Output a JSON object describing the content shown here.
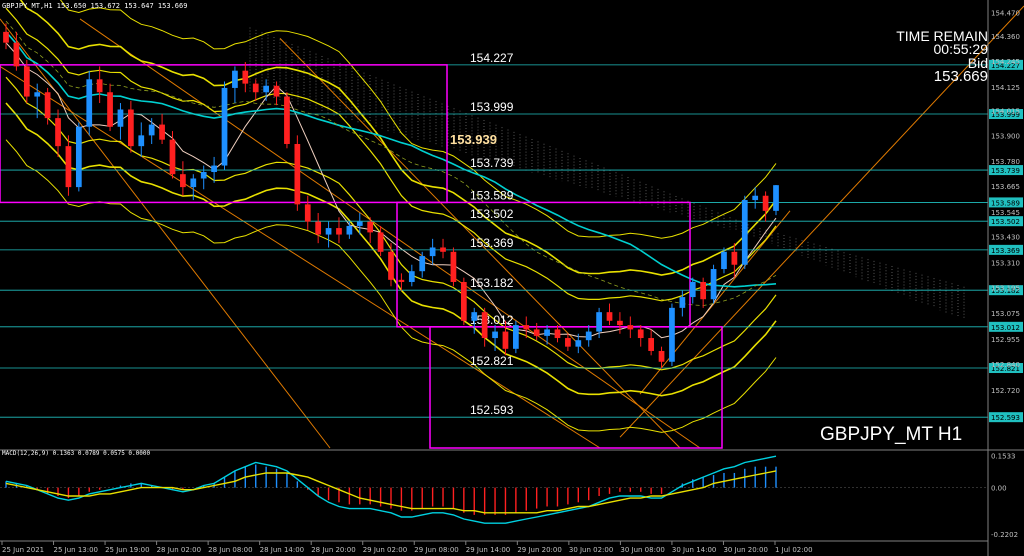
{
  "header": {
    "text": "GBPJPY_MT,H1  153.650 153.672 153.647 153.669"
  },
  "info": {
    "label": "TIME REMAIN",
    "countdown": "00:55:29",
    "bid_label": "Bid",
    "bid_value": "153.669"
  },
  "symbol_label": "GBPJPY_MT H1",
  "macd_header": "MACD(12,26,9) 0.1363 0.0789 0.0575 0.0000",
  "chart_data": {
    "type": "candlestick",
    "price_axis": {
      "min": 152.45,
      "max": 154.5,
      "ticks": [
        "154.470",
        "154.360",
        "154.245",
        "154.125",
        "154.015",
        "153.900",
        "153.780",
        "153.665",
        "153.545",
        "153.430",
        "153.310",
        "153.195",
        "153.075",
        "152.955",
        "152.840",
        "152.720"
      ]
    },
    "x_ticks": [
      "25 Jun 2021",
      "25 Jun 13:00",
      "25 Jun 19:00",
      "28 Jun 02:00",
      "28 Jun 08:00",
      "28 Jun 14:00",
      "28 Jun 20:00",
      "29 Jun 02:00",
      "29 Jun 08:00",
      "29 Jun 14:00",
      "29 Jun 20:00",
      "30 Jun 02:00",
      "30 Jun 08:00",
      "30 Jun 14:00",
      "30 Jun 20:00",
      "1 Jul 02:00"
    ],
    "levels": [
      {
        "label": "154.227",
        "value": 154.227
      },
      {
        "label": "153.999",
        "value": 153.999
      },
      {
        "label": "153.739",
        "value": 153.739
      },
      {
        "label": "153.589",
        "value": 153.589
      },
      {
        "label": "153.502",
        "value": 153.502
      },
      {
        "label": "153.369",
        "value": 153.369
      },
      {
        "label": "153.182",
        "value": 153.182
      },
      {
        "label": "153.012",
        "value": 153.012
      },
      {
        "label": "152.821",
        "value": 152.821
      },
      {
        "label": "152.593",
        "value": 152.593
      }
    ],
    "highlight_label": "153.939",
    "candles": [
      [
        154.38,
        154.42,
        154.3,
        154.33
      ],
      [
        154.33,
        154.38,
        154.2,
        154.22
      ],
      [
        154.22,
        154.25,
        154.05,
        154.08
      ],
      [
        154.08,
        154.14,
        153.98,
        154.1
      ],
      [
        154.1,
        154.12,
        153.95,
        153.98
      ],
      [
        153.98,
        154.02,
        153.8,
        153.85
      ],
      [
        153.85,
        153.9,
        153.62,
        153.66
      ],
      [
        153.66,
        153.96,
        153.64,
        153.94
      ],
      [
        153.94,
        154.2,
        153.9,
        154.16
      ],
      [
        154.16,
        154.22,
        154.05,
        154.1
      ],
      [
        154.1,
        154.14,
        153.92,
        153.94
      ],
      [
        153.94,
        154.05,
        153.88,
        154.02
      ],
      [
        154.02,
        154.06,
        153.82,
        153.85
      ],
      [
        153.85,
        153.96,
        153.8,
        153.9
      ],
      [
        153.9,
        153.98,
        153.86,
        153.95
      ],
      [
        153.95,
        154.0,
        153.86,
        153.88
      ],
      [
        153.88,
        153.92,
        153.7,
        153.72
      ],
      [
        153.72,
        153.78,
        153.62,
        153.66
      ],
      [
        153.66,
        153.72,
        153.6,
        153.7
      ],
      [
        153.7,
        153.76,
        153.65,
        153.73
      ],
      [
        153.73,
        153.8,
        153.68,
        153.76
      ],
      [
        153.76,
        154.15,
        153.74,
        154.12
      ],
      [
        154.12,
        154.22,
        154.05,
        154.2
      ],
      [
        154.2,
        154.24,
        154.1,
        154.14
      ],
      [
        154.14,
        154.16,
        154.06,
        154.1
      ],
      [
        154.1,
        154.16,
        154.06,
        154.13
      ],
      [
        154.13,
        154.15,
        154.04,
        154.08
      ],
      [
        154.08,
        154.1,
        153.84,
        153.86
      ],
      [
        153.86,
        153.9,
        153.55,
        153.58
      ],
      [
        153.58,
        153.62,
        153.46,
        153.5
      ],
      [
        153.5,
        153.54,
        153.4,
        153.44
      ],
      [
        153.44,
        153.5,
        153.38,
        153.47
      ],
      [
        153.47,
        153.52,
        153.4,
        153.44
      ],
      [
        153.44,
        153.5,
        153.42,
        153.48
      ],
      [
        153.48,
        153.54,
        153.44,
        153.5
      ],
      [
        153.5,
        153.52,
        153.4,
        153.45
      ],
      [
        153.45,
        153.48,
        153.34,
        153.36
      ],
      [
        153.36,
        153.4,
        153.2,
        153.23
      ],
      [
        153.23,
        153.26,
        153.18,
        153.22
      ],
      [
        153.22,
        153.3,
        153.2,
        153.27
      ],
      [
        153.27,
        153.36,
        153.24,
        153.34
      ],
      [
        153.34,
        153.42,
        153.3,
        153.38
      ],
      [
        153.38,
        153.42,
        153.33,
        153.36
      ],
      [
        153.36,
        153.38,
        153.2,
        153.22
      ],
      [
        153.22,
        153.24,
        153.02,
        153.04
      ],
      [
        153.04,
        153.1,
        152.98,
        153.08
      ],
      [
        153.08,
        153.1,
        152.92,
        152.96
      ],
      [
        152.96,
        153.02,
        152.9,
        152.99
      ],
      [
        152.99,
        153.04,
        152.88,
        152.91
      ],
      [
        152.91,
        153.04,
        152.89,
        153.02
      ],
      [
        153.02,
        153.06,
        152.96,
        153.0
      ],
      [
        153.0,
        153.03,
        152.95,
        152.97
      ],
      [
        152.97,
        153.02,
        152.93,
        153.0
      ],
      [
        153.0,
        153.02,
        152.94,
        152.96
      ],
      [
        152.96,
        152.98,
        152.9,
        152.92
      ],
      [
        152.92,
        152.98,
        152.89,
        152.95
      ],
      [
        152.95,
        153.02,
        152.92,
        152.99
      ],
      [
        152.99,
        153.1,
        152.96,
        153.08
      ],
      [
        153.08,
        153.12,
        153.02,
        153.04
      ],
      [
        153.04,
        153.08,
        152.98,
        153.02
      ],
      [
        153.02,
        153.06,
        152.96,
        153.0
      ],
      [
        153.0,
        153.02,
        152.92,
        152.96
      ],
      [
        152.96,
        153.0,
        152.88,
        152.9
      ],
      [
        152.9,
        152.92,
        152.82,
        152.85
      ],
      [
        152.85,
        153.12,
        152.83,
        153.1
      ],
      [
        153.1,
        153.18,
        153.06,
        153.15
      ],
      [
        153.15,
        153.24,
        153.12,
        153.22
      ],
      [
        153.22,
        153.24,
        153.1,
        153.14
      ],
      [
        153.14,
        153.3,
        153.12,
        153.28
      ],
      [
        153.28,
        153.38,
        153.26,
        153.36
      ],
      [
        153.36,
        153.4,
        153.24,
        153.3
      ],
      [
        153.3,
        153.62,
        153.28,
        153.6
      ],
      [
        153.6,
        153.66,
        153.56,
        153.62
      ],
      [
        153.62,
        153.64,
        153.5,
        153.55
      ],
      [
        153.55,
        153.67,
        153.53,
        153.669
      ]
    ],
    "macd": {
      "range": [
        -0.25,
        0.17
      ],
      "ticks": [
        "0.1533",
        "0.00",
        "-0.2202"
      ],
      "histogram": [
        0.03,
        0.02,
        0.01,
        -0.01,
        -0.03,
        -0.04,
        -0.05,
        -0.04,
        -0.02,
        -0.01,
        0.0,
        0.01,
        0.02,
        0.02,
        0.01,
        0.0,
        -0.01,
        -0.01,
        0.0,
        0.01,
        0.02,
        0.05,
        0.08,
        0.1,
        0.11,
        0.1,
        0.09,
        0.07,
        0.03,
        -0.01,
        -0.04,
        -0.06,
        -0.07,
        -0.08,
        -0.08,
        -0.08,
        -0.09,
        -0.1,
        -0.11,
        -0.11,
        -0.1,
        -0.09,
        -0.09,
        -0.1,
        -0.12,
        -0.13,
        -0.13,
        -0.13,
        -0.13,
        -0.12,
        -0.11,
        -0.1,
        -0.09,
        -0.09,
        -0.08,
        -0.07,
        -0.06,
        -0.04,
        -0.03,
        -0.02,
        -0.02,
        -0.02,
        -0.03,
        -0.03,
        0.0,
        0.02,
        0.04,
        0.05,
        0.06,
        0.07,
        0.07,
        0.09,
        0.1,
        0.1,
        0.1
      ],
      "signal": [
        0.02,
        0.01,
        0.0,
        -0.01,
        -0.02,
        -0.03,
        -0.04,
        -0.04,
        -0.04,
        -0.03,
        -0.03,
        -0.02,
        -0.01,
        0.0,
        0.0,
        0.0,
        0.0,
        -0.01,
        -0.01,
        0.0,
        0.01,
        0.02,
        0.03,
        0.05,
        0.06,
        0.07,
        0.07,
        0.07,
        0.06,
        0.05,
        0.03,
        0.01,
        -0.01,
        -0.03,
        -0.05,
        -0.06,
        -0.07,
        -0.08,
        -0.09,
        -0.1,
        -0.1,
        -0.1,
        -0.1,
        -0.1,
        -0.11,
        -0.11,
        -0.12,
        -0.12,
        -0.12,
        -0.12,
        -0.12,
        -0.12,
        -0.11,
        -0.11,
        -0.1,
        -0.09,
        -0.09,
        -0.08,
        -0.07,
        -0.06,
        -0.05,
        -0.05,
        -0.04,
        -0.04,
        -0.03,
        -0.02,
        -0.01,
        0.0,
        0.02,
        0.03,
        0.04,
        0.05,
        0.06,
        0.07,
        0.08
      ],
      "line": [
        0.03,
        0.02,
        0.01,
        -0.01,
        -0.03,
        -0.05,
        -0.06,
        -0.05,
        -0.03,
        -0.02,
        -0.01,
        0.0,
        0.01,
        0.02,
        0.01,
        0.0,
        -0.01,
        -0.02,
        -0.01,
        0.01,
        0.02,
        0.05,
        0.08,
        0.1,
        0.12,
        0.11,
        0.1,
        0.08,
        0.04,
        0.0,
        -0.04,
        -0.07,
        -0.09,
        -0.1,
        -0.1,
        -0.1,
        -0.11,
        -0.12,
        -0.14,
        -0.14,
        -0.13,
        -0.12,
        -0.12,
        -0.13,
        -0.15,
        -0.16,
        -0.17,
        -0.17,
        -0.17,
        -0.16,
        -0.15,
        -0.14,
        -0.13,
        -0.12,
        -0.11,
        -0.1,
        -0.09,
        -0.07,
        -0.05,
        -0.04,
        -0.04,
        -0.04,
        -0.05,
        -0.05,
        -0.02,
        0.01,
        0.03,
        0.05,
        0.07,
        0.09,
        0.1,
        0.12,
        0.13,
        0.14,
        0.15
      ]
    }
  },
  "colors": {
    "bull": "#1e90ff",
    "bear": "#ff2020",
    "level": "#20c0c0",
    "box": "#ff00ff",
    "band": "#e8e000",
    "trend": "#e07a00",
    "ma": "#00d0d0",
    "axis": "#808080",
    "bg": "#000000"
  }
}
